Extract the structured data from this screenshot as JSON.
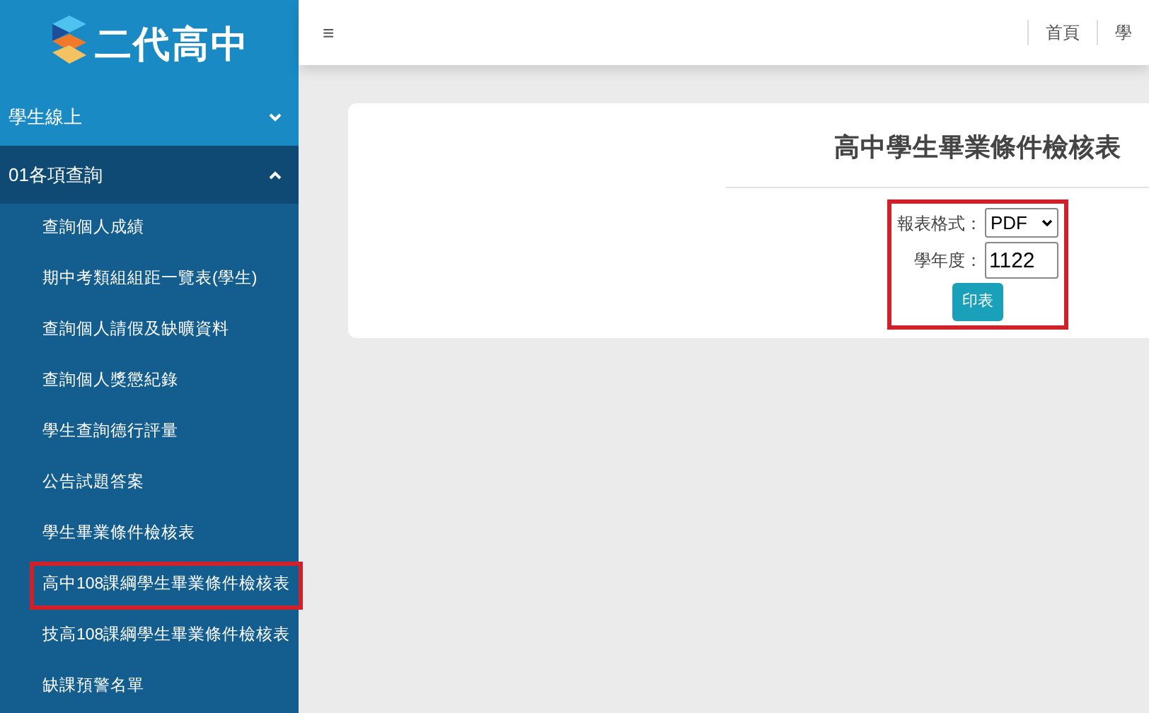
{
  "logo": {
    "text": "二代高中"
  },
  "sidebar": {
    "sections": [
      {
        "label": "學生線上",
        "expanded": false
      },
      {
        "label": "01各項查詢",
        "expanded": true,
        "children": [
          {
            "label": "查詢個人成績",
            "highlighted": false
          },
          {
            "label": "期中考類組組距一覽表(學生)",
            "highlighted": false
          },
          {
            "label": "查詢個人請假及缺曠資料",
            "highlighted": false
          },
          {
            "label": "查詢個人獎懲紀錄",
            "highlighted": false
          },
          {
            "label": "學生查詢德行評量",
            "highlighted": false
          },
          {
            "label": "公告試題答案",
            "highlighted": false
          },
          {
            "label": "學生畢業條件檢核表",
            "highlighted": false
          },
          {
            "label": "高中108課綱學生畢業條件檢核表",
            "highlighted": true
          },
          {
            "label": "技高108課綱學生畢業條件檢核表",
            "highlighted": false
          },
          {
            "label": "缺課預警名單",
            "highlighted": false
          }
        ]
      }
    ]
  },
  "header": {
    "menu_icon": "≡",
    "nav": [
      "首頁",
      "學"
    ]
  },
  "card": {
    "title": "高中學生畢業條件檢核表",
    "form": {
      "highlighted": true,
      "format_label": "報表格式：",
      "format_value": "PDF",
      "year_label": "學年度：",
      "year_value": "1122",
      "print_button": "印表"
    }
  }
}
